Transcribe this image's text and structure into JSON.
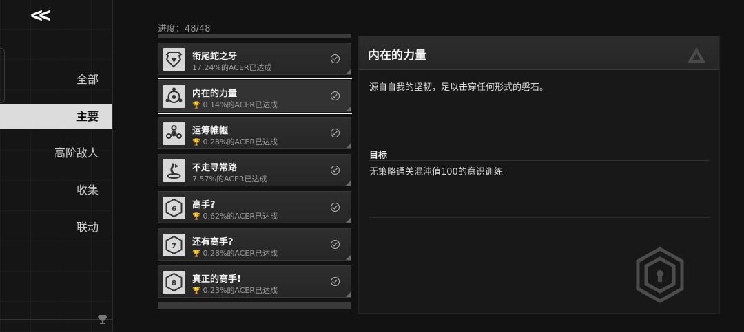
{
  "nav": {
    "back_label": "<<",
    "items": [
      {
        "label": "全部"
      },
      {
        "label": "主要"
      },
      {
        "label": "高阶敌人"
      },
      {
        "label": "收集"
      },
      {
        "label": "联动"
      }
    ],
    "active_index": 1
  },
  "progress": "进度：48/48",
  "achievements": [
    {
      "name": "衔尾蛇之牙",
      "rate": "17.24%的ACER已达成",
      "trophy": false,
      "icon": "serpent-icon"
    },
    {
      "name": "内在的力量",
      "rate": "0.14%的ACER已达成",
      "trophy": true,
      "icon": "inner-power-icon"
    },
    {
      "name": "运筹帷幄",
      "rate": "0.28%的ACER已达成",
      "trophy": true,
      "icon": "strategy-icon"
    },
    {
      "name": "不走寻常路",
      "rate": "7.57%的ACER已达成",
      "trophy": false,
      "icon": "unusual-path-icon"
    },
    {
      "name": "高手?",
      "rate": "0.62%的ACER已达成",
      "trophy": true,
      "icon": "hex-6-icon"
    },
    {
      "name": "还有高手?",
      "rate": "0.28%的ACER已达成",
      "trophy": true,
      "icon": "hex-7-icon"
    },
    {
      "name": "真正的高手!",
      "rate": "0.23%的ACER已达成",
      "trophy": true,
      "icon": "hex-8-icon"
    }
  ],
  "selected_index": 1,
  "detail": {
    "title": "内在的力量",
    "description": "源自自我的坚韧，足以击穿任何形式的磐石。",
    "goal_label": "目标",
    "goal_text": "无策略通关混沌值100的意识训练"
  }
}
